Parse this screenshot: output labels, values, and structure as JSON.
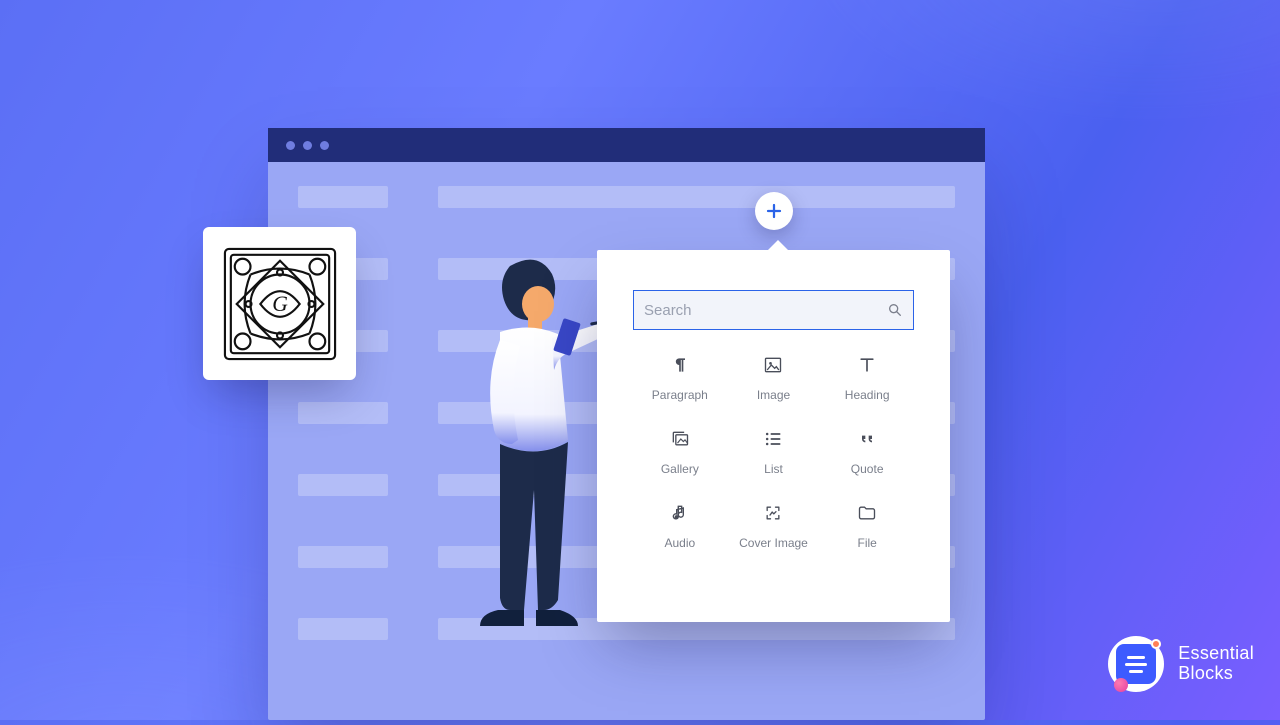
{
  "search": {
    "placeholder": "Search"
  },
  "blocks": {
    "b0": {
      "label": "Paragraph"
    },
    "b1": {
      "label": "Image"
    },
    "b2": {
      "label": "Heading"
    },
    "b3": {
      "label": "Gallery"
    },
    "b4": {
      "label": "List"
    },
    "b5": {
      "label": "Quote"
    },
    "b6": {
      "label": "Audio"
    },
    "b7": {
      "label": "Cover Image"
    },
    "b8": {
      "label": "File"
    }
  },
  "brand": {
    "line1": "Essential",
    "line2": "Blocks"
  }
}
